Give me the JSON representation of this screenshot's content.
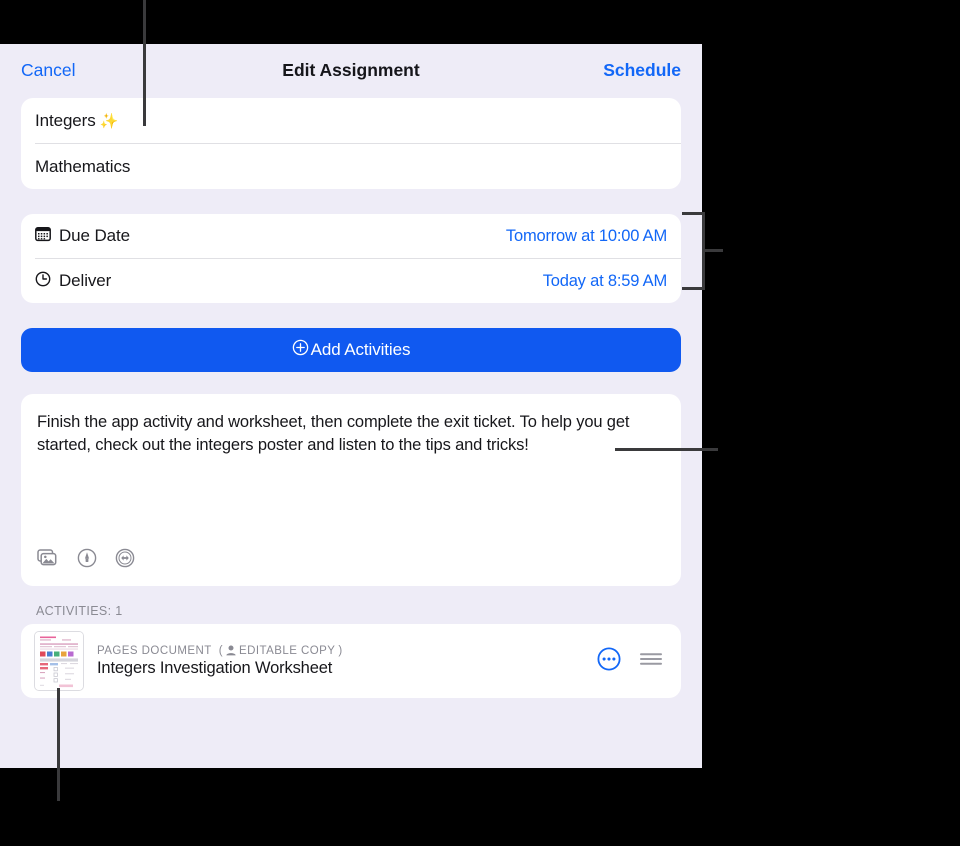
{
  "navbar": {
    "cancel_label": "Cancel",
    "title": "Edit Assignment",
    "schedule_label": "Schedule"
  },
  "fields": {
    "title_value": "Integers",
    "title_emoji": "✨",
    "subject_value": "Mathematics"
  },
  "dates": {
    "due": {
      "icon": "calendar-icon",
      "label": "Due Date",
      "value": "Tomorrow at 10:00 AM"
    },
    "deliver": {
      "icon": "clock-icon",
      "label": "Deliver",
      "value": "Today at 8:59 AM"
    }
  },
  "add_activities": {
    "icon": "plus-circle-icon",
    "label": "Add Activities"
  },
  "instructions": {
    "text": "Finish the app activity and worksheet, then complete the exit ticket. To help you get started, check out the integers poster and listen to the tips and tricks!",
    "toolbar": [
      {
        "icon": "photos-icon",
        "name": "insert-photo-button"
      },
      {
        "icon": "markup-icon",
        "name": "insert-markup-button"
      },
      {
        "icon": "audio-icon",
        "name": "insert-audio-button"
      }
    ]
  },
  "activities": {
    "header": "ACTIVITIES: 1",
    "items": [
      {
        "kind": "PAGES DOCUMENT",
        "copy_badge": "EDITABLE COPY",
        "copy_badge_icon": "person-icon",
        "title": "Integers Investigation Worksheet",
        "more_icon": "more-circle-icon",
        "reorder_icon": "reorder-handle-icon"
      }
    ]
  },
  "colors": {
    "accent_blue": "#1267f7",
    "button_blue": "#1059f0",
    "sheet_background": "#eeecf7",
    "card_background": "#ffffff",
    "secondary_text": "#8a8a93",
    "callout_line": "#3a3a3c"
  }
}
